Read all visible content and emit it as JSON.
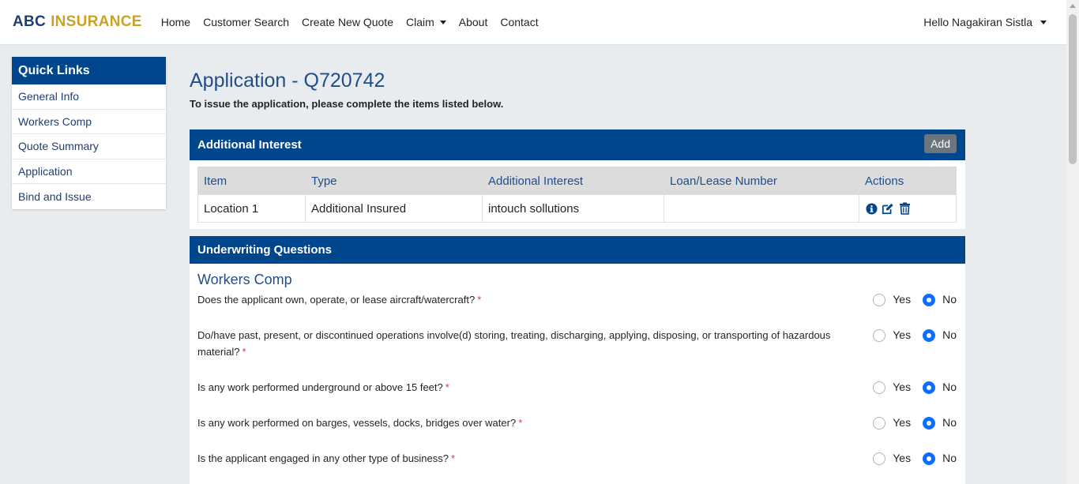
{
  "brand": {
    "part1": "ABC",
    "part2": "INSURANCE"
  },
  "nav": {
    "home": "Home",
    "customer_search": "Customer Search",
    "create_quote": "Create New Quote",
    "claim": "Claim",
    "about": "About",
    "contact": "Contact",
    "user": "Hello Nagakiran Sistla"
  },
  "sidebar": {
    "title": "Quick Links",
    "items": [
      {
        "label": "General Info"
      },
      {
        "label": "Workers Comp"
      },
      {
        "label": "Quote Summary"
      },
      {
        "label": "Application"
      },
      {
        "label": "Bind and Issue"
      }
    ]
  },
  "page": {
    "title": "Application - Q720742",
    "subtitle": "To issue the application, please complete the items listed below."
  },
  "additional_interest": {
    "title": "Additional Interest",
    "add_label": "Add",
    "columns": [
      "Item",
      "Type",
      "Additional Interest",
      "Loan/Lease Number",
      "Actions"
    ],
    "rows": [
      {
        "item": "Location 1",
        "type": "Additional Insured",
        "interest": "intouch sollutions",
        "loan": ""
      }
    ]
  },
  "underwriting": {
    "title": "Underwriting Questions",
    "section": "Workers Comp",
    "yes_label": "Yes",
    "no_label": "No",
    "required_mark": "*",
    "questions": [
      {
        "text": "Does the applicant own, operate, or lease aircraft/watercraft?",
        "answer": "No"
      },
      {
        "text": "Do/have past, present, or discontinued operations involve(d) storing, treating, discharging, applying, disposing, or transporting of hazardous material?",
        "answer": "No"
      },
      {
        "text": "Is any work performed underground or above 15 feet?",
        "answer": "No"
      },
      {
        "text": "Is any work performed on barges, vessels, docks, bridges over water?",
        "answer": "No"
      },
      {
        "text": "Is the applicant engaged in any other type of business?",
        "answer": "No"
      }
    ]
  },
  "colors": {
    "primary": "#00468c",
    "heading": "#1f4e8a",
    "radio_on": "#0d6efd",
    "required": "#dc3545"
  }
}
